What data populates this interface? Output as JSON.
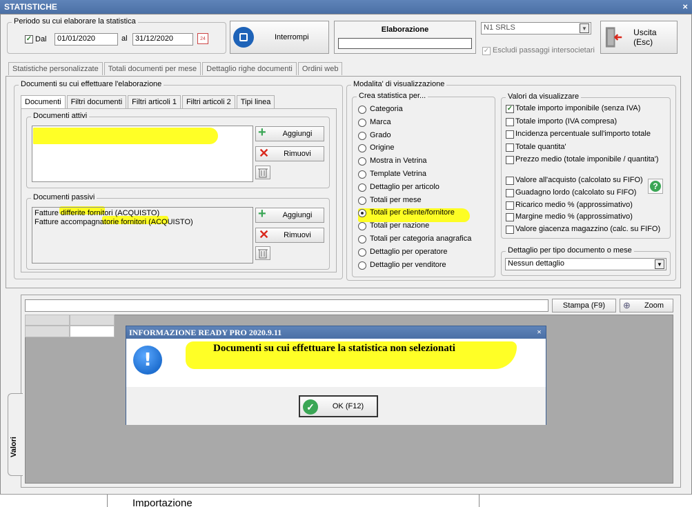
{
  "window": {
    "title": "STATISTICHE",
    "close": "×"
  },
  "periodo": {
    "group_label": "Periodo su cui elaborare la statistica",
    "dal_label": "Dal",
    "dal_checked": true,
    "dal_value": "01/01/2020",
    "al_label": "al",
    "al_value": "31/12/2020",
    "calendar_icon_text": "24"
  },
  "interrompi": {
    "label": "Interrompi"
  },
  "elaborazione": {
    "label": "Elaborazione"
  },
  "company": {
    "selected": "N1 SRLS",
    "escludi_label": "Escludi passaggi intersocietari"
  },
  "uscita": {
    "label": "Uscita (Esc)"
  },
  "main_tabs": [
    "Statistiche personalizzate",
    "Totali documenti per mese",
    "Dettaglio righe documenti",
    "Ordini web"
  ],
  "documenti_group": {
    "label": "Documenti su cui effettuare l'elaborazione",
    "sub_tabs": [
      "Documenti",
      "Filtri documenti",
      "Filtri articoli 1",
      "Filtri articoli 2",
      "Tipi linea"
    ],
    "attivi_label": "Documenti attivi",
    "passivi_label": "Documenti passivi",
    "passivi_items": [
      "Fatture differite fornitori (ACQUISTO)",
      "Fatture accompagnatorie fornitori (ACQUISTO)"
    ],
    "aggiungi": "Aggiungi",
    "rimuovi": "Rimuovi"
  },
  "modalita": {
    "label": "Modalita' di visualizzazione",
    "crea_label": "Crea statistica per...",
    "options": [
      "Categoria",
      "Marca",
      "Grado",
      "Origine",
      "Mostra in Vetrina",
      "Template Vetrina",
      "Dettaglio per articolo",
      "Totali per mese",
      "Totali per cliente/fornitore",
      "Totali per nazione",
      "Totali per categoria anagrafica",
      "Dettaglio per operatore",
      "Dettaglio per venditore"
    ],
    "selected_index": 8,
    "valori_label": "Valori da visualizzare",
    "valori": [
      {
        "label": "Totale importo imponibile (senza IVA)",
        "checked": true
      },
      {
        "label": "Totale importo (IVA compresa)",
        "checked": false
      },
      {
        "label": "Incidenza percentuale sull'importo totale",
        "checked": false
      },
      {
        "label": "Totale quantita'",
        "checked": false
      },
      {
        "label": "Prezzo medio (totale imponibile / quantita')",
        "checked": false
      }
    ],
    "valori2": [
      {
        "label": "Valore all'acquisto (calcolato su FIFO)",
        "checked": false
      },
      {
        "label": "Guadagno lordo (calcolato su FIFO)",
        "checked": false
      },
      {
        "label": "Ricarico medio % (approssimativo)",
        "checked": false
      },
      {
        "label": "Margine medio % (approssimativo)",
        "checked": false
      },
      {
        "label": "Valore giacenza magazzino (calc. su FIFO)",
        "checked": false
      }
    ],
    "dettaglio_label": "Dettaglio per tipo documento o mese",
    "dettaglio_value": "Nessun dettaglio"
  },
  "bottom": {
    "stampa": "Stampa (F9)",
    "zoom": "Zoom",
    "side_tab": "Valori",
    "bottom_text": "Importazione"
  },
  "dialog": {
    "title": "INFORMAZIONE READY PRO 2020.9.11",
    "close": "×",
    "message": "Documenti su cui effettuare la statistica non selezionati",
    "ok": "OK (F12)"
  },
  "colors": {
    "title_bar": "#4a6fa5",
    "highlight": "#ffff00",
    "info_blue": "#1f6fd0",
    "ok_green": "#3aa655",
    "remove_red": "#d9281c"
  }
}
